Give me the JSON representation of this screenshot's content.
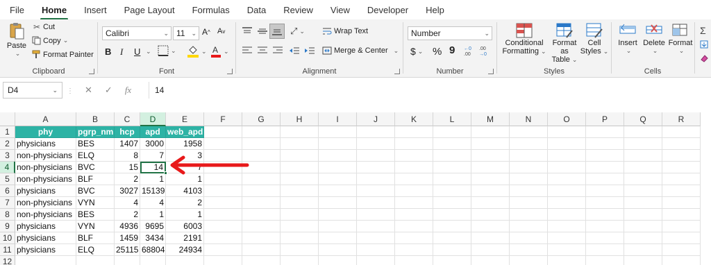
{
  "menu": [
    "File",
    "Home",
    "Insert",
    "Page Layout",
    "Formulas",
    "Data",
    "Review",
    "View",
    "Developer",
    "Help"
  ],
  "active_menu": "Home",
  "ribbon": {
    "clipboard": {
      "paste": "Paste",
      "cut": "Cut",
      "copy": "Copy",
      "format_painter": "Format Painter",
      "label": "Clipboard"
    },
    "font": {
      "name": "Calibri",
      "size": "11",
      "bold": "B",
      "italic": "I",
      "underline": "U",
      "label": "Font"
    },
    "alignment": {
      "wrap_text": "Wrap Text",
      "merge_center": "Merge & Center",
      "label": "Alignment"
    },
    "number": {
      "format": "Number",
      "currency": "$",
      "percent": "%",
      "comma": "9",
      "label": "Number"
    },
    "styles": {
      "conditional": "Conditional",
      "conditional2": "Formatting",
      "format_as": "Format as",
      "format_as2": "Table",
      "cell": "Cell",
      "cell2": "Styles",
      "label": "Styles"
    },
    "cells": {
      "insert": "Insert",
      "delete": "Delete",
      "format": "Format",
      "label": "Cells"
    }
  },
  "formula_bar": {
    "name_box": "D4",
    "cancel": "✕",
    "enter": "✓",
    "fx": "fx",
    "value": "14"
  },
  "columns": [
    "A",
    "B",
    "C",
    "D",
    "E",
    "F",
    "G",
    "H",
    "I",
    "J",
    "K",
    "L",
    "M",
    "N",
    "O",
    "P",
    "Q",
    "R"
  ],
  "rows": [
    "1",
    "2",
    "3",
    "4",
    "5",
    "6",
    "7",
    "8",
    "9",
    "10",
    "11",
    "12"
  ],
  "selected": {
    "col": "D",
    "row": "4"
  },
  "table": {
    "headers": [
      "phy",
      "pgrp_nm",
      "hcp",
      "apd",
      "web_apd"
    ],
    "data": [
      [
        "physicians",
        "BES",
        "1407",
        "3000",
        "1958"
      ],
      [
        "non-physicians",
        "ELQ",
        "8",
        "7",
        "3"
      ],
      [
        "non-physicians",
        "BVC",
        "15",
        "14",
        "7"
      ],
      [
        "non-physicians",
        "BLF",
        "2",
        "1",
        "1"
      ],
      [
        "physicians",
        "BVC",
        "3027",
        "15139",
        "4103"
      ],
      [
        "non-physicians",
        "VYN",
        "4",
        "4",
        "2"
      ],
      [
        "non-physicians",
        "BES",
        "2",
        "1",
        "1"
      ],
      [
        "physicians",
        "VYN",
        "4936",
        "9695",
        "6003"
      ],
      [
        "physicians",
        "BLF",
        "1459",
        "3434",
        "2191"
      ],
      [
        "physicians",
        "ELQ",
        "25115",
        "68804",
        "24934"
      ]
    ]
  },
  "colors": {
    "accent": "#217346",
    "header_fill": "#2db3a5",
    "arrow": "#e8191a"
  },
  "arrow_icon": "red-arrow-left-icon"
}
